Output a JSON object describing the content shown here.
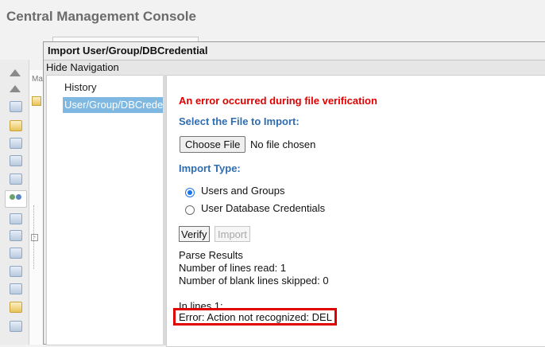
{
  "app": {
    "title": "Central Management Console"
  },
  "background": {
    "vertical_tab_label": "Ma"
  },
  "dialog": {
    "title": "Import User/Group/DBCredential",
    "hide_navigation": "Hide Navigation",
    "nav": {
      "items": [
        {
          "label": "History",
          "selected": false
        },
        {
          "label": "User/Group/DBCredential",
          "selected": true
        }
      ]
    },
    "content": {
      "error_heading": "An error occurred during file verification",
      "file_section_label": "Select the File to Import:",
      "choose_file_button": "Choose File",
      "file_status": "No file chosen",
      "import_type_label": "Import Type:",
      "import_type_options": [
        {
          "label": "Users and Groups",
          "checked": true
        },
        {
          "label": "User Database Credentials",
          "checked": false
        }
      ],
      "verify_button": "Verify",
      "import_button": "Import",
      "parse_results": {
        "heading": "Parse Results",
        "lines_read": "Number of lines read: 1",
        "blank_lines_skipped": "Number of blank lines skipped: 0",
        "in_lines": "In lines 1:",
        "error_message": "Error: Action not recognized: DEL"
      }
    }
  },
  "colors": {
    "error_text": "#e00000",
    "section_label": "#2f6db0",
    "selected_nav": "#7fb8e0",
    "radio_checked": "#1a73e8"
  }
}
